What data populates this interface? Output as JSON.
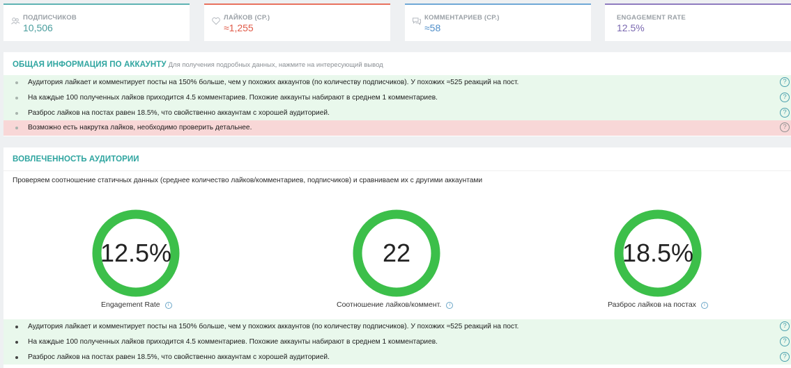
{
  "stats": [
    {
      "icon": "people-icon",
      "label": "ПОДПИСЧИКОВ",
      "value": "10,506",
      "color": "#4a9e9e"
    },
    {
      "icon": "heart-icon",
      "label": "ЛАЙКОВ (СР.)",
      "value": "≈1,255",
      "color": "#e05a48"
    },
    {
      "icon": "comment-icon",
      "label": "КОММЕНТАРИЕВ (СР.)",
      "value": "≈58",
      "color": "#4f8ec9"
    },
    {
      "label": "ENGAGEMENT RATE",
      "value": "12.5%",
      "color": "#7a68b0"
    }
  ],
  "general": {
    "title": "ОБЩАЯ ИНФОРМАЦИЯ ПО АККАУНТУ",
    "subtitle": "Для получения подробных данных, нажмите на интересующий вывод",
    "rows": [
      {
        "text": "Аудитория лайкает и комментирует посты на 150% больше, чем у похожих аккаунтов (по количеству подписчиков). У похожих ≈525 реакций на пост.",
        "status": "ok"
      },
      {
        "text": "На каждые 100 полученных лайков приходится 4.5 комментариев. Похожие аккаунты набирают в среднем 1 комментариев.",
        "status": "ok"
      },
      {
        "text": "Разброс лайков на постах равен 18.5%, что свойственно аккаунтам с хорошей аудиторией.",
        "status": "ok"
      },
      {
        "text": "Возможно есть накрутка лайков, необходимо проверить детальнее.",
        "status": "bad"
      }
    ]
  },
  "engagement": {
    "title": "ВОВЛЕЧЕННОСТЬ АУДИТОРИИ",
    "description": "Проверяем соотношение статичных данных (среднее количество лайков/комментариев, подписчиков) и сравниваем их с другими аккаунтами",
    "gauges": [
      {
        "value": "12.5%",
        "label": "Engagement Rate"
      },
      {
        "value": "22",
        "label": "Соотношение лайков/коммент."
      },
      {
        "value": "18.5%",
        "label": "Разброс лайков на постах"
      }
    ],
    "gauge_color": "#3cbf4a",
    "rows": [
      {
        "text": "Аудитория лайкает и комментирует посты на 150% больше, чем у похожих аккаунтов (по количеству подписчиков). У похожих ≈525 реакций на пост.",
        "status": "ok"
      },
      {
        "text": "На каждые 100 полученных лайков приходится 4.5 комментариев. Похожие аккаунты набирают в среднем 1 комментариев.",
        "status": "ok"
      },
      {
        "text": "Разброс лайков на постах равен 18.5%, что свойственно аккаунтам с хорошей аудиторией.",
        "status": "ok"
      }
    ]
  },
  "help_glyph": "?",
  "info_glyph": "i"
}
